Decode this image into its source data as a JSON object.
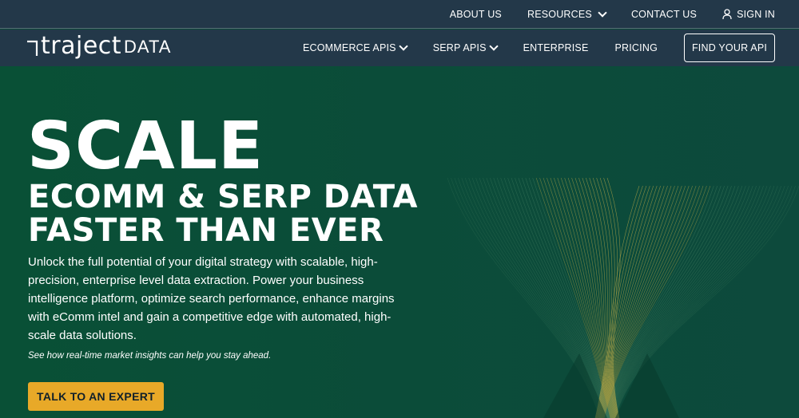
{
  "topbar": {
    "about": "ABOUT US",
    "resources": "RESOURCES",
    "contact": "CONTACT US",
    "signin": "SIGN IN"
  },
  "navbar": {
    "logo_traject": "traject",
    "logo_data": "DATA",
    "ecommerce": "ECOMMERCE APIS",
    "serp": "SERP APIS",
    "enterprise": "ENTERPRISE",
    "pricing": "PRICING",
    "find_api": "FIND YOUR API"
  },
  "hero": {
    "headline_big": "SCALE",
    "headline_line1": "ECOMM & SERP DATA",
    "headline_line2": "FASTER THAN EVER",
    "description": "Unlock the full potential of your digital strategy with scalable, high-precision, enterprise level data extraction. Power your business intelligence platform, optimize search performance, enhance margins with eComm intel and gain a competitive edge with automated, high-scale data solutions.",
    "note": "See how real-time market insights can help you stay ahead.",
    "cta": "TALK TO AN EXPERT"
  },
  "colors": {
    "nav_bg": "#233849",
    "hero_bg": "#0b4a37",
    "accent": "#e8a928"
  },
  "icons": {
    "resources_chevron": "chevron-down-icon",
    "signin_user": "user-icon"
  }
}
